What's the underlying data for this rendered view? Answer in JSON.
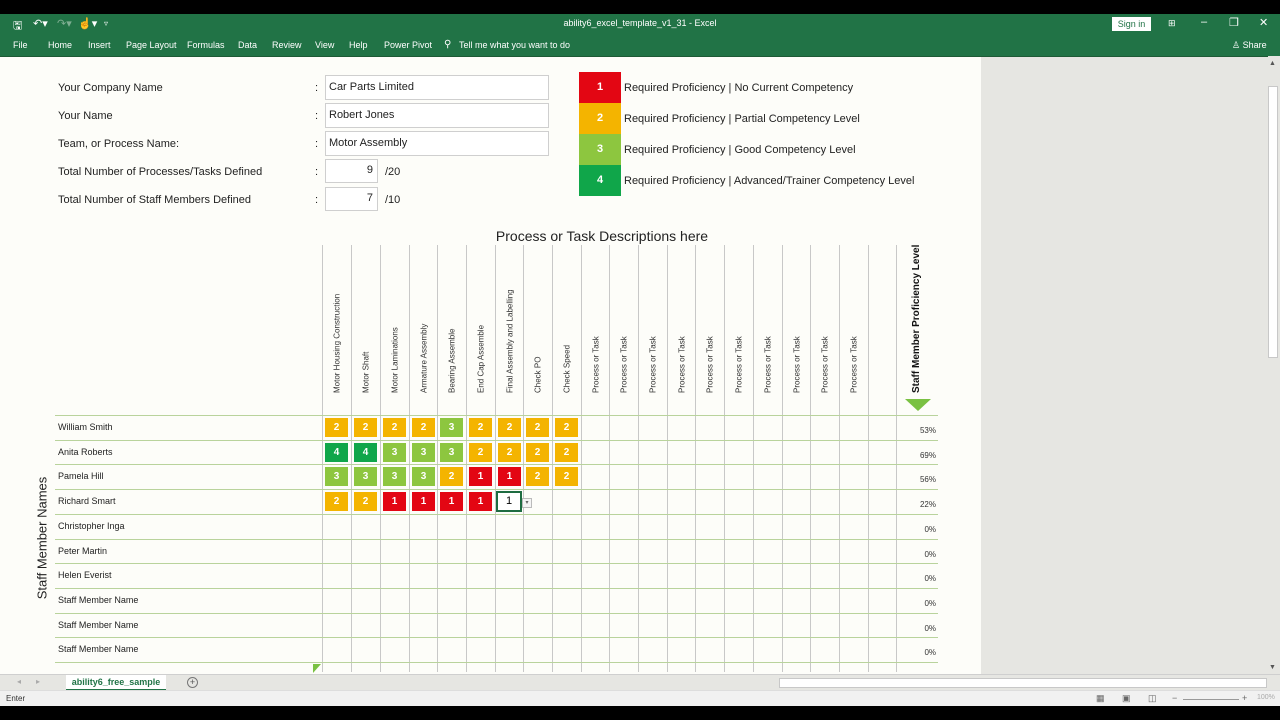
{
  "window": {
    "title": "ability6_excel_template_v1_31  -  Excel",
    "sign_in": "Sign in",
    "share": "Share",
    "qat": {
      "save": "save-icon",
      "undo": "undo-icon",
      "redo": "redo-icon",
      "touch": "touch-mode-icon",
      "customize": "customize-icon"
    },
    "controls": {
      "ribbon_display": "ribbon-display-icon",
      "minimize": "–",
      "restore": "❐",
      "close": "✕"
    }
  },
  "ribbon": {
    "tabs": [
      "File",
      "Home",
      "Insert",
      "Page Layout",
      "Formulas",
      "Data",
      "Review",
      "View",
      "Help",
      "Power Pivot"
    ],
    "tell_me": "Tell me what you want to do"
  },
  "form": {
    "company_label": "Your Company Name",
    "company_value": "Car Parts Limited",
    "name_label": "Your Name",
    "name_value": "Robert Jones",
    "team_label": "Team, or Process Name:",
    "team_value": "Motor Assembly",
    "processes_label": "Total Number of Processes/Tasks Defined",
    "processes_value": "9",
    "processes_max": "/20",
    "staff_label": "Total Number of Staff Members Defined",
    "staff_value": "7",
    "staff_max": "/10",
    "colon": ":"
  },
  "legend": [
    {
      "level": "1",
      "text": "Required Proficiency | No Current Competency",
      "color": "#e30613"
    },
    {
      "level": "2",
      "text": "Required Proficiency | Partial Competency Level",
      "color": "#f4b400"
    },
    {
      "level": "3",
      "text": "Required Proficiency | Good Competency Level",
      "color": "#8dc63f"
    },
    {
      "level": "4",
      "text": "Required Proficiency | Advanced/Trainer Competency Level",
      "color": "#10a64a"
    }
  ],
  "matrix": {
    "title": "Process or Task Descriptions here",
    "row_axis_label": "Staff Member Names",
    "proficiency_header": "Staff Member Proficiency Level",
    "tasks": [
      "Motor Housing Construction",
      "Motor Shaft",
      "Motor Laminations",
      "Armature Assembly",
      "Bearing Assemble",
      "End Cap Assemble",
      "Final Assembly and Labelling",
      "Check PO",
      "Check Speed",
      "Process or Task",
      "Process or Task",
      "Process or Task",
      "Process or Task",
      "Process or Task",
      "Process or Task",
      "Process or Task",
      "Process or Task",
      "Process or Task",
      "Process or Task"
    ],
    "staff": [
      {
        "name": "William Smith",
        "scores": [
          2,
          2,
          2,
          2,
          3,
          2,
          2,
          2,
          2
        ],
        "proficiency": "53%"
      },
      {
        "name": "Anita Roberts",
        "scores": [
          4,
          4,
          3,
          3,
          3,
          2,
          2,
          2,
          2
        ],
        "proficiency": "69%"
      },
      {
        "name": "Pamela Hill",
        "scores": [
          3,
          3,
          3,
          3,
          2,
          1,
          1,
          2,
          2
        ],
        "proficiency": "56%"
      },
      {
        "name": "Richard Smart",
        "scores": [
          2,
          2,
          1,
          1,
          1,
          1
        ],
        "proficiency": "22%",
        "editing_value": "1"
      },
      {
        "name": "Christopher Inga",
        "scores": [],
        "proficiency": "0%"
      },
      {
        "name": "Peter Martin",
        "scores": [],
        "proficiency": "0%"
      },
      {
        "name": "Helen Everist",
        "scores": [],
        "proficiency": "0%"
      },
      {
        "name": "Staff Member Name",
        "scores": [],
        "proficiency": "0%"
      },
      {
        "name": "Staff Member Name",
        "scores": [],
        "proficiency": "0%"
      },
      {
        "name": "Staff Member Name",
        "scores": [],
        "proficiency": "0%"
      }
    ]
  },
  "sheet_tabs": {
    "active": "ability6_free_sample",
    "add_icon": "+"
  },
  "status": {
    "mode": "Enter",
    "zoom": "100%"
  }
}
